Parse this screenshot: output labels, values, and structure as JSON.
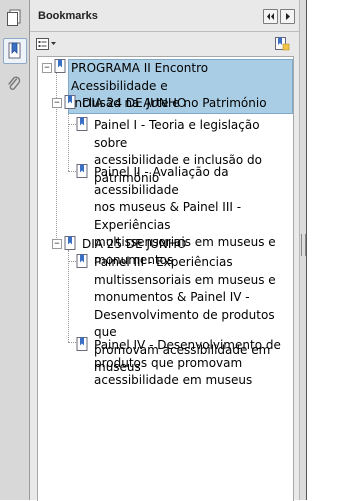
{
  "panel": {
    "title": "Bookmarks"
  },
  "icons": {
    "page_thumbnails": "pages-icon",
    "bookmarks": "bookmark-ribbon-icon",
    "attachments": "paperclip-icon",
    "options": "options-menu-icon",
    "new_bookmark": "new-bookmark-icon"
  },
  "colors": {
    "selection": "#a9cde4",
    "panel_bg": "#e9e9e9",
    "nav_bg": "#d8d8d8"
  },
  "bookmarks": {
    "root": {
      "line1": "PROGRAMA II Encontro Acessibilidade e",
      "line2": "Inclusão na Arte e no Património"
    },
    "day1": {
      "label": "DIA 24 DE JUNHO",
      "p1": [
        "Painel I - Teoria e legislação sobre",
        "acessibilidade e inclusão do",
        "património"
      ],
      "p2": [
        "Painel II - Avaliação da acessibilidade",
        "nos museus & Painel III - Experiências",
        "multissensoriais em museus e",
        "monumentos"
      ]
    },
    "day2": {
      "label": "DIA 25 DE JUNHO",
      "p1": [
        "Painel III - Experiências",
        "multissensoriais em museus e",
        "monumentos & Painel IV -",
        "Desenvolvimento de produtos que",
        "promovam acessibilidade em museus"
      ],
      "p2": [
        "Painel IV - Desenvolvimento de",
        "produtos que promovam",
        "acessibilidade em museus"
      ]
    }
  }
}
